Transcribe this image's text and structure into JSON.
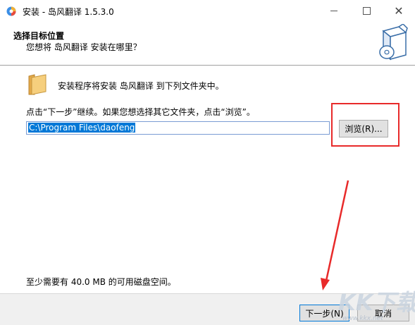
{
  "window": {
    "title": "安装 - 岛风翻译 1.5.3.0",
    "minimize_glyph": "",
    "maximize_glyph": "",
    "close_glyph": "✕"
  },
  "header": {
    "title": "选择目标位置",
    "subtitle": "您想将 岛风翻译 安装在哪里？"
  },
  "body": {
    "info_text": "安装程序将安装 岛风翻译 到下列文件夹中。",
    "instruction": "点击“下一步”继续。如果您想选择其它文件夹，点击“浏览”。",
    "path_value": "C:\\Program Files\\daofeng",
    "browse_label": "浏览(R)...",
    "space_text": "至少需要有 40.0 MB 的可用磁盘空间。"
  },
  "footer": {
    "next_label": "下一步(N)",
    "cancel_label": "取消"
  },
  "watermark": {
    "logo_text": "KK下载",
    "url": "www.kkx.net"
  },
  "colors": {
    "annotation": "#e82a2a",
    "selection": "#0078d7",
    "folder": "#f0c060"
  },
  "icons": {
    "app": "app-logo-icon",
    "wizard": "install-box-icon",
    "folder": "folder-icon"
  }
}
